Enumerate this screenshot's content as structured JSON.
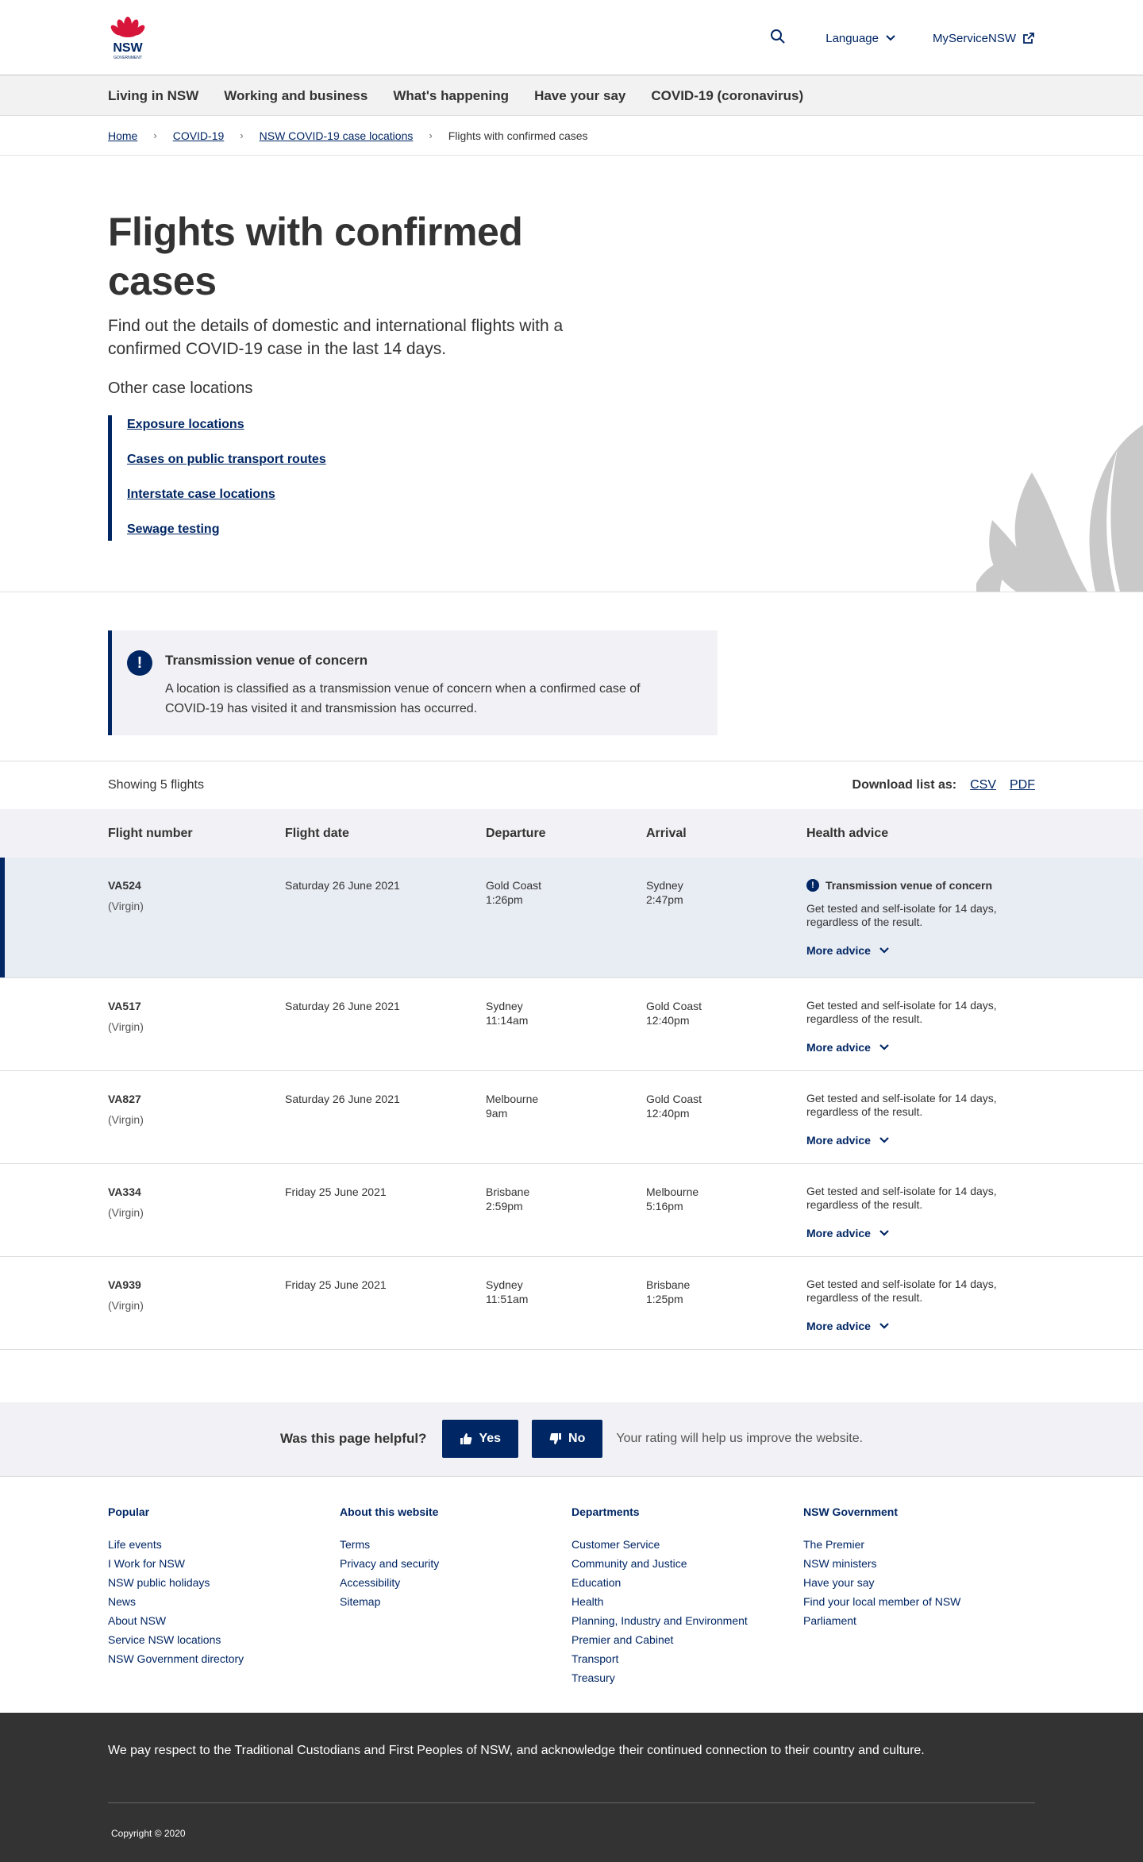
{
  "header": {
    "logo_text": "NSW",
    "logo_subtext": "GOVERNMENT",
    "language_label": "Language",
    "myservice_label": "MyServiceNSW"
  },
  "nav": [
    "Living in NSW",
    "Working and business",
    "What's happening",
    "Have your say",
    "COVID-19 (coronavirus)"
  ],
  "breadcrumb": {
    "items": [
      "Home",
      "COVID-19",
      "NSW COVID-19 case locations"
    ],
    "current": "Flights with confirmed cases"
  },
  "hero": {
    "title": "Flights with confirmed cases",
    "lede": "Find out the details of domestic and international flights with a confirmed COVID-19 case in the last 14 days.",
    "other_heading": "Other case locations",
    "links": [
      "Exposure locations",
      "Cases on public transport routes",
      "Interstate case locations",
      "Sewage testing"
    ]
  },
  "callout": {
    "title": "Transmission venue of concern",
    "body": "A location is classified as a transmission venue of concern when a confirmed case of COVID-19 has visited it and transmission has occurred."
  },
  "controls": {
    "showing": "Showing 5 flights",
    "download_label": "Download list as:",
    "csv": "CSV",
    "pdf": "PDF"
  },
  "table": {
    "headers": [
      "Flight number",
      "Flight date",
      "Departure",
      "Arrival",
      "Health advice"
    ],
    "rows": [
      {
        "flight": "VA524",
        "airline": "(Virgin)",
        "date": "Saturday 26 June 2021",
        "dep_place": "Gold Coast",
        "dep_time": "1:26pm",
        "arr_place": "Sydney",
        "arr_time": "2:47pm",
        "tvc": "Transmission venue of concern",
        "advice": "Get tested and self-isolate for 14 days, regardless of the result.",
        "more": "More advice"
      },
      {
        "flight": "VA517",
        "airline": "(Virgin)",
        "date": "Saturday 26 June 2021",
        "dep_place": "Sydney",
        "dep_time": "11:14am",
        "arr_place": "Gold Coast",
        "arr_time": "12:40pm",
        "advice": "Get tested and self-isolate for 14 days, regardless of the result.",
        "more": "More advice"
      },
      {
        "flight": "VA827",
        "airline": "(Virgin)",
        "date": "Saturday 26 June 2021",
        "dep_place": "Melbourne",
        "dep_time": "9am",
        "arr_place": "Gold Coast",
        "arr_time": "12:40pm",
        "advice": "Get tested and self-isolate for 14 days, regardless of the result.",
        "more": "More advice"
      },
      {
        "flight": "VA334",
        "airline": "(Virgin)",
        "date": "Friday 25 June 2021",
        "dep_place": "Brisbane",
        "dep_time": "2:59pm",
        "arr_place": "Melbourne",
        "arr_time": "5:16pm",
        "advice": "Get tested and self-isolate for 14 days, regardless of the result.",
        "more": "More advice"
      },
      {
        "flight": "VA939",
        "airline": "(Virgin)",
        "date": "Friday 25 June 2021",
        "dep_place": "Sydney",
        "dep_time": "11:51am",
        "arr_place": "Brisbane",
        "arr_time": "1:25pm",
        "advice": "Get tested and self-isolate for 14 days, regardless of the result.",
        "more": "More advice"
      }
    ]
  },
  "feedback": {
    "question": "Was this page helpful?",
    "yes": "Yes",
    "no": "No",
    "note": "Your rating will help us improve the website."
  },
  "footer": {
    "columns": [
      {
        "heading": "Popular",
        "links": [
          "Life events",
          "I Work for NSW",
          "NSW public holidays",
          "News",
          "About NSW",
          "Service NSW locations",
          "NSW Government directory"
        ]
      },
      {
        "heading": "About this website",
        "links": [
          "Terms",
          "Privacy and security",
          "Accessibility",
          "Sitemap"
        ]
      },
      {
        "heading": "Departments",
        "links": [
          "Customer Service",
          "Community and Justice",
          "Education",
          "Health",
          "Planning, Industry and Environment",
          "Premier and Cabinet",
          "Transport",
          "Treasury"
        ]
      },
      {
        "heading": "NSW Government",
        "links": [
          "The Premier",
          "NSW ministers",
          "Have your say",
          "Find your local member of NSW",
          "Parliament"
        ]
      }
    ],
    "acknowledgement": "We pay respect to the Traditional Custodians and First Peoples of NSW, and acknowledge their continued connection to their country and culture.",
    "copyright": "Copyright © 2020"
  },
  "colors": {
    "brand_navy": "#002664",
    "brand_red": "#d7153a",
    "alert_row_bg": "#e8ecf3",
    "footer_bg": "#333333"
  }
}
